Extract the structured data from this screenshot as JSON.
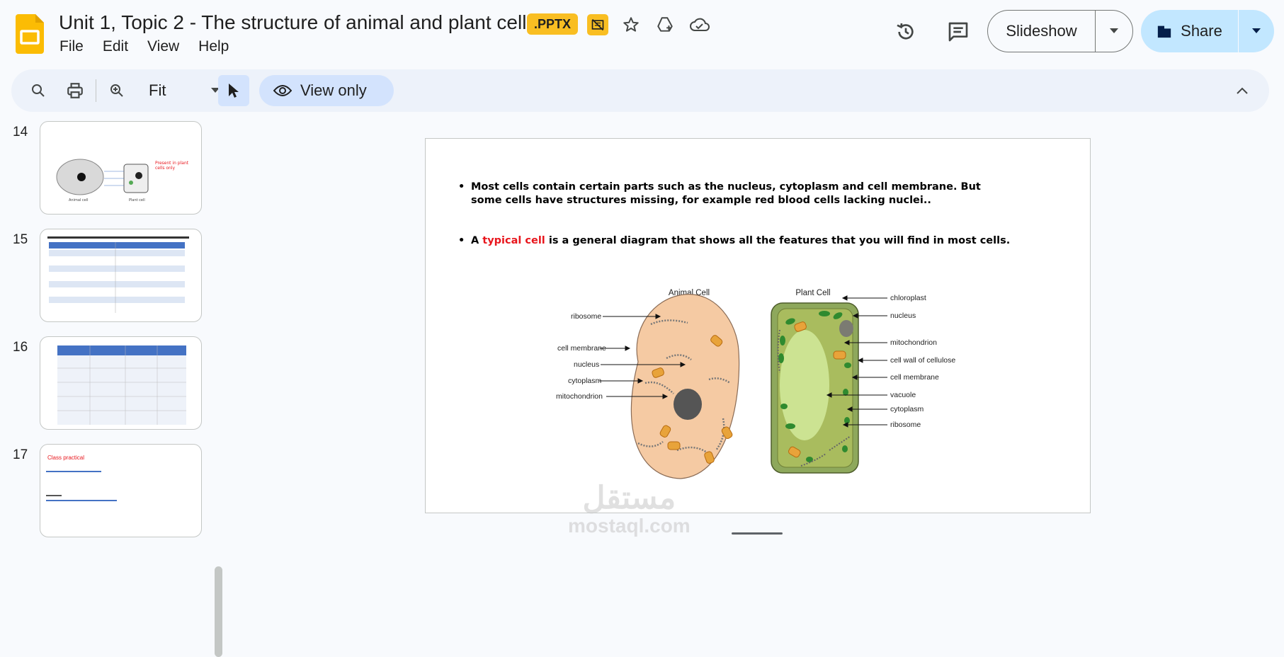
{
  "header": {
    "title": "Unit 1, Topic 2 - The structure of animal and plant cells",
    "badge": ".PPTX",
    "menus": [
      "File",
      "Edit",
      "View",
      "Help"
    ],
    "slideshow_label": "Slideshow",
    "share_label": "Share"
  },
  "toolbar": {
    "zoom_value": "Fit",
    "view_mode_label": "View only"
  },
  "filmstrip": {
    "slides": [
      {
        "number": "14"
      },
      {
        "number": "15"
      },
      {
        "number": "16"
      },
      {
        "number": "17",
        "title": "Class practical"
      }
    ]
  },
  "slide": {
    "bullet1": "Most cells contain certain parts such as the nucleus, cytoplasm and cell membrane. But some cells have structures missing, for example red blood cells lacking nuclei..",
    "bullet2_pre": "A ",
    "bullet2_highlight": "typical cell",
    "bullet2_post": " is a general diagram that shows all the features that you will find in most cells.",
    "diagram": {
      "animal_title": "Animal Cell",
      "plant_title": "Plant Cell",
      "animal_labels": [
        "ribosome",
        "cell membrane",
        "nucleus",
        "cytoplasm",
        "mitochondrion"
      ],
      "plant_labels": [
        "chloroplast",
        "nucleus",
        "mitochondrion",
        "cell wall of cellulose",
        "cell membrane",
        "vacuole",
        "cytoplasm",
        "ribosome"
      ]
    }
  },
  "watermark": {
    "arabic": "مستقل",
    "latin": "mostaql.com"
  },
  "colors": {
    "accent_blue": "#c2e7ff",
    "badge_yellow": "#f9be22",
    "highlight_red": "#e8161d"
  }
}
